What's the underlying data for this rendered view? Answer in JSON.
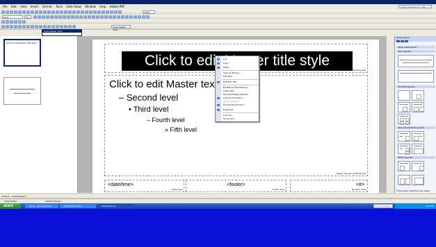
{
  "menubar": {
    "items": [
      "File",
      "Edit",
      "View",
      "Insert",
      "Format",
      "Tools",
      "Slide Show",
      "Window",
      "Help",
      "Adobe PDF"
    ],
    "ask_placeholder": "Type a question for help"
  },
  "toolbar": {
    "zoom": "100%",
    "font_name": "Arial",
    "font_size": "44",
    "close_master_view": "Close Master View"
  },
  "master_view": {
    "title": "Slide Master View"
  },
  "thumbnail": {
    "title": "Click to edit Master title style"
  },
  "slide": {
    "title": "Click to edit Master title style",
    "title_area_label": "Title Area for AutoLayouts",
    "body_area_label": "Object Area for AutoLayouts",
    "levels": [
      "Click to edit Master text styles",
      "– Second level",
      "• Third level",
      "– Fourth level",
      "» Fifth level"
    ],
    "date": "<date/time>",
    "date_area": "Date Area",
    "footer": "<footer>",
    "footer_area": "Footer Area",
    "number": "<#>",
    "number_area": "Number Area"
  },
  "context_menu": {
    "items": [
      "Cut",
      "Copy",
      "Paste",
      "Save as Picture...",
      "Edit Text",
      "Exit Edit Text",
      "Bullets and Numbering...",
      "Insert Text",
      "Set AutoShape Defaults",
      "Custom Animation...",
      "Action Settings...",
      "Format Placeholder...",
      "Hyperlink...",
      "Look Up...",
      "Synonyms"
    ]
  },
  "task_pane": {
    "title": "Slide Layout",
    "apply_label": "Apply slide layout:",
    "sections": [
      "Text Layouts",
      "Content Layouts",
      "Text and Content Layouts",
      "Other Layouts"
    ],
    "show_when_inserting": "Show when inserting new slides"
  },
  "statusbar": {
    "view": "Slide Master",
    "design": "Default Design"
  },
  "taskbar": {
    "start": "start",
    "tasks": [
      "Inbox - Microsoft Out...",
      "PPT Master View...",
      "Presentation1"
    ],
    "search_placeholder": "Search Desktop",
    "clock": "4:15 PM"
  }
}
